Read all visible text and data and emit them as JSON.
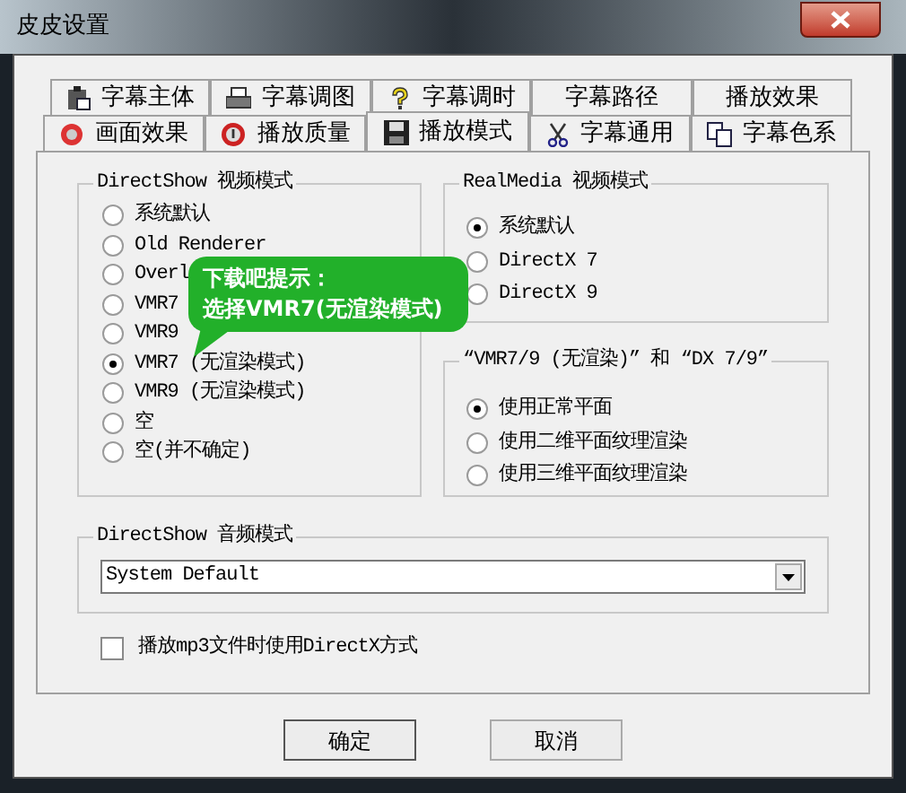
{
  "window": {
    "title": "皮皮设置"
  },
  "tabs": [
    {
      "label": "字幕主体",
      "selected": false
    },
    {
      "label": "字幕调图",
      "selected": false
    },
    {
      "label": "字幕调时",
      "selected": false
    },
    {
      "label": "字幕路径",
      "selected": false
    },
    {
      "label": "播放效果",
      "selected": false
    },
    {
      "label": "画面效果",
      "selected": false
    },
    {
      "label": "播放质量",
      "selected": false
    },
    {
      "label": "播放模式",
      "selected": true
    },
    {
      "label": "字幕通用",
      "selected": false
    },
    {
      "label": "字幕色系",
      "selected": false
    }
  ],
  "directshow_video": {
    "title": "DirectShow 视频模式",
    "options": [
      {
        "label": "系统默认",
        "selected": false
      },
      {
        "label": "Old Renderer",
        "selected": false
      },
      {
        "label": "Overl",
        "selected": false
      },
      {
        "label": "VMR7",
        "selected": false
      },
      {
        "label": "VMR9",
        "selected": false
      },
      {
        "label": "VMR7 (无渲染模式)",
        "selected": true
      },
      {
        "label": "VMR9 (无渲染模式)",
        "selected": false
      },
      {
        "label": "空",
        "selected": false
      },
      {
        "label": "空(并不确定)",
        "selected": false
      }
    ]
  },
  "realmedia_video": {
    "title": "RealMedia 视频模式",
    "options": [
      {
        "label": "系统默认",
        "selected": true
      },
      {
        "label": "DirectX 7",
        "selected": false
      },
      {
        "label": "DirectX 9",
        "selected": false
      }
    ]
  },
  "vmr_dx": {
    "title": "“VMR7/9 (无渲染)” 和 “DX 7/9”",
    "options": [
      {
        "label": "使用正常平面",
        "selected": true
      },
      {
        "label": "使用二维平面纹理渲染",
        "selected": false
      },
      {
        "label": "使用三维平面纹理渲染",
        "selected": false
      }
    ]
  },
  "directshow_audio": {
    "title": "DirectShow 音频模式",
    "value": "System Default"
  },
  "mp3_directx": {
    "label": "播放mp3文件时使用DirectX方式",
    "checked": false
  },
  "tooltip": {
    "lines": [
      "下载吧提示：",
      "选择VMR7(无渲染模式)"
    ]
  },
  "buttons": [
    "确定",
    "取消"
  ]
}
